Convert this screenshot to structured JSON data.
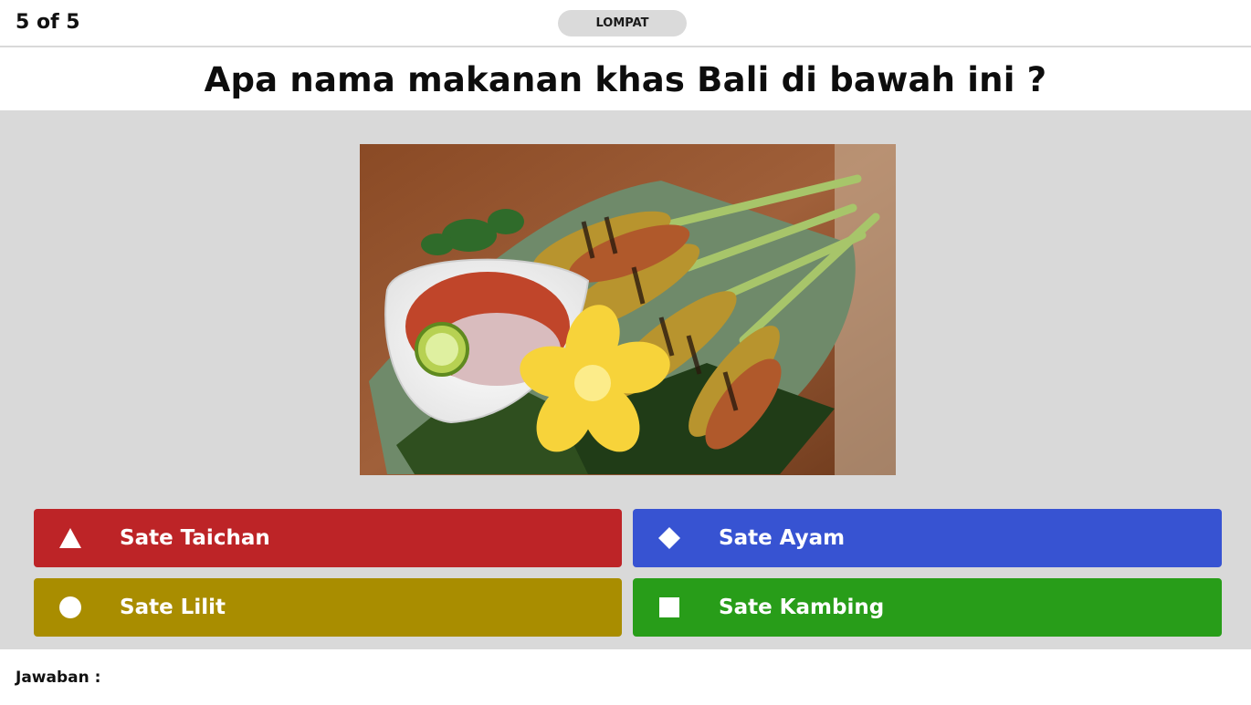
{
  "header": {
    "counter": "5 of 5",
    "skip_label": "LOMPAT"
  },
  "question": {
    "text": "Apa nama makanan khas Bali di bawah ini ?"
  },
  "image": {
    "alt": "Sate lilit dengan sambal matah dan bunga kamboja"
  },
  "answers": [
    {
      "label": "Sate Taichan",
      "icon": "triangle-icon",
      "color": "#bd2427"
    },
    {
      "label": "Sate Ayam",
      "icon": "diamond-icon",
      "color": "#3753d2"
    },
    {
      "label": "Sate Lilit",
      "icon": "circle-icon",
      "color": "#a98d00"
    },
    {
      "label": "Sate Kambing",
      "icon": "square-icon",
      "color": "#289d19"
    }
  ],
  "footer": {
    "answer_label": "Jawaban :"
  }
}
